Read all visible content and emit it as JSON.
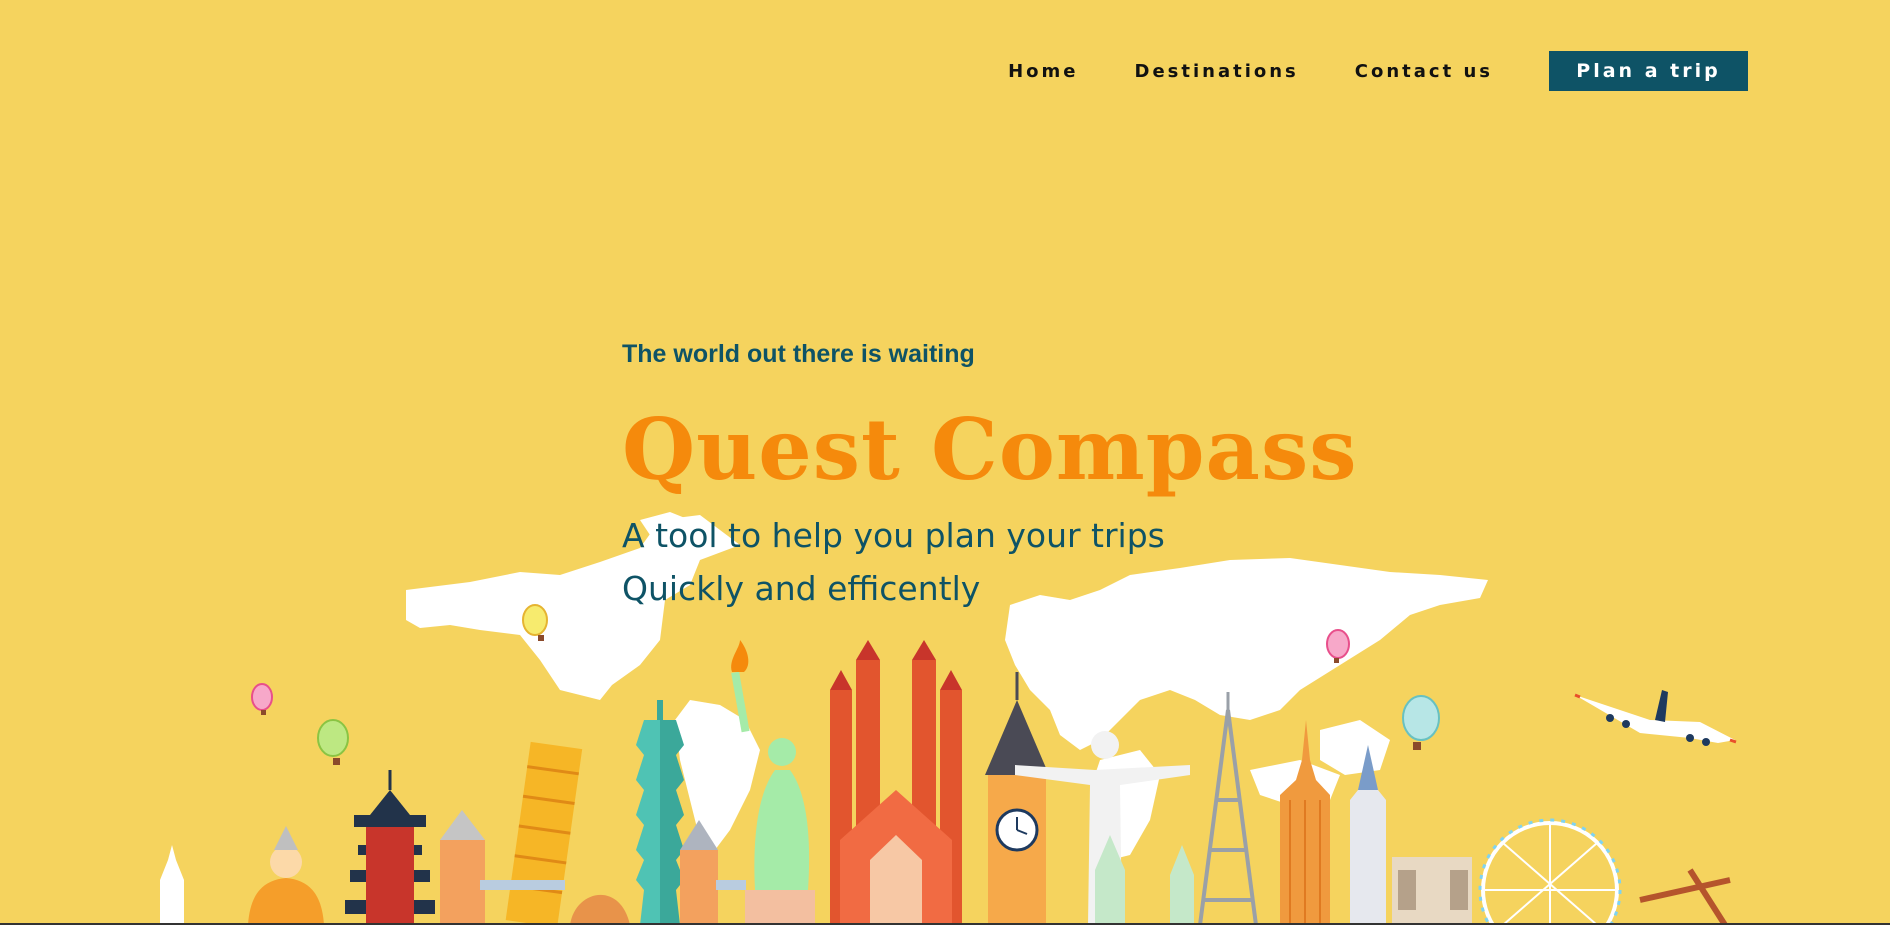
{
  "nav": {
    "links": [
      "Home",
      "Destinations",
      "Contact us"
    ],
    "cta_label": "Plan a trip"
  },
  "hero": {
    "tagline": "The world out there is waiting",
    "brand": "Quest Compass",
    "subtitle_line1": "A tool to help you plan your trips",
    "subtitle_line2": "Quickly and efficently"
  },
  "colors": {
    "background": "#F5D35E",
    "accent_teal": "#0E5366",
    "brand_orange": "#F58A0C"
  },
  "illustration": {
    "icons": [
      "world-map-icon",
      "hot-air-balloon-icon",
      "airplane-icon",
      "landmarks-skyline-icon"
    ]
  }
}
